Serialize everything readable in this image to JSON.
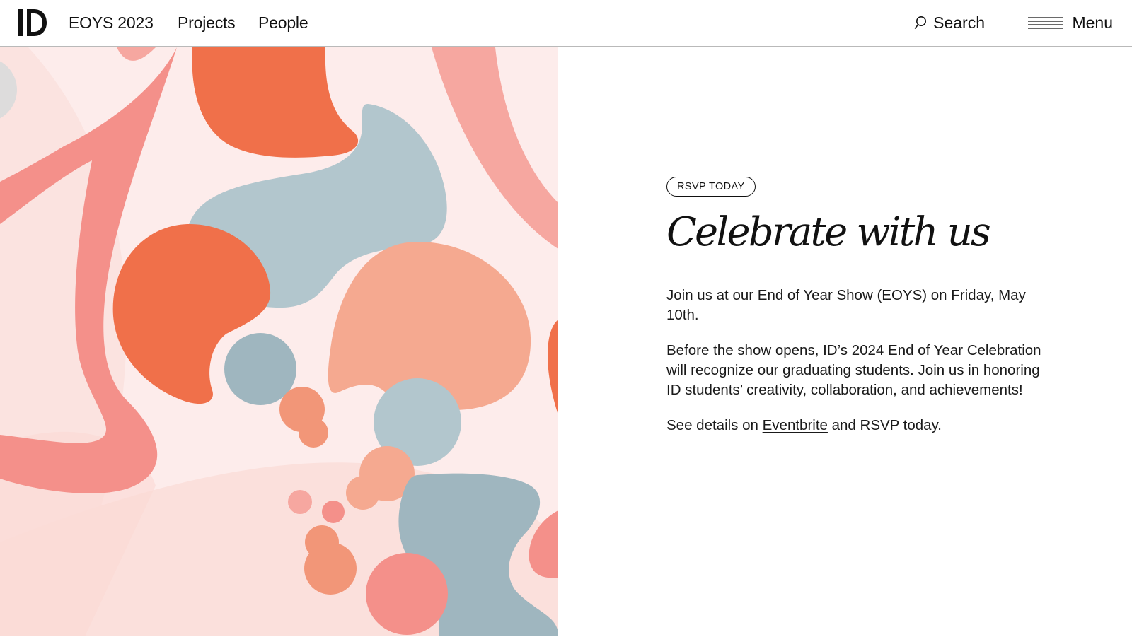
{
  "header": {
    "logo_text": "ID",
    "nav": [
      {
        "label": "EOYS 2023"
      },
      {
        "label": "Projects"
      },
      {
        "label": "People"
      }
    ],
    "search_label": "Search",
    "menu_label": "Menu"
  },
  "hero": {
    "image_icon": "abstract-blob-illustration",
    "colors": {
      "background": "#fdeceb",
      "orange": "#f0704a",
      "blue_gray": "#9fb6bf",
      "peach": "#f5a58f",
      "salmon": "#f2908a"
    }
  },
  "content": {
    "badge": "RSVP TODAY",
    "title": "Celebrate with us",
    "paragraph_1": "Join us at our End of Year Show (EOYS) on Friday, May 10th.",
    "paragraph_2": "Before the show opens, ID’s 2024 End of Year Celebration will recognize our graduating students. Join us in honoring ID students’ creativity, collaboration, and achievements!",
    "paragraph_3_before": "See details on ",
    "paragraph_3_link": "Eventbrite",
    "paragraph_3_after": " and RSVP today."
  }
}
